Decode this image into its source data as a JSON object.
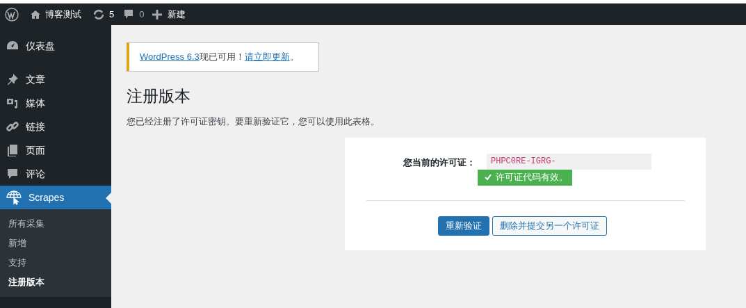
{
  "admin_bar": {
    "site_name": "博客测试",
    "updates": "5",
    "comments": "0",
    "new_label": "新建"
  },
  "sidebar": {
    "items": [
      {
        "label": "仪表盘",
        "kind": "dashboard",
        "selected": false
      },
      {
        "label": "文章",
        "kind": "pin",
        "selected": false
      },
      {
        "label": "媒体",
        "kind": "media",
        "selected": false
      },
      {
        "label": "链接",
        "kind": "link",
        "selected": false
      },
      {
        "label": "页面",
        "kind": "pages",
        "selected": false
      },
      {
        "label": "评论",
        "kind": "comment",
        "selected": false
      },
      {
        "label": "Scrapes",
        "kind": "globe",
        "selected": true,
        "children": [
          {
            "label": "所有采集",
            "selected": false
          },
          {
            "label": "新增",
            "selected": false
          },
          {
            "label": "支持",
            "selected": false
          },
          {
            "label": "注册版本",
            "selected": true
          }
        ]
      }
    ]
  },
  "notice": {
    "link": "WordPress 6.3",
    "text": "现已可用！",
    "action": "请立即更新",
    "end": "。"
  },
  "page": {
    "title": "注册版本",
    "description": "您已经注册了许可证密钥。要重新验证它，您可以使用此表格。"
  },
  "license": {
    "label": "您当前的许可证：",
    "value": "PHPC0RE-IGRG-",
    "status": "许可证代码有效。",
    "valid": true,
    "buttons": [
      {
        "label": "重新验证",
        "kind": "primary"
      },
      {
        "label": "删除并提交另一个许可证",
        "kind": "secondary"
      }
    ]
  }
}
